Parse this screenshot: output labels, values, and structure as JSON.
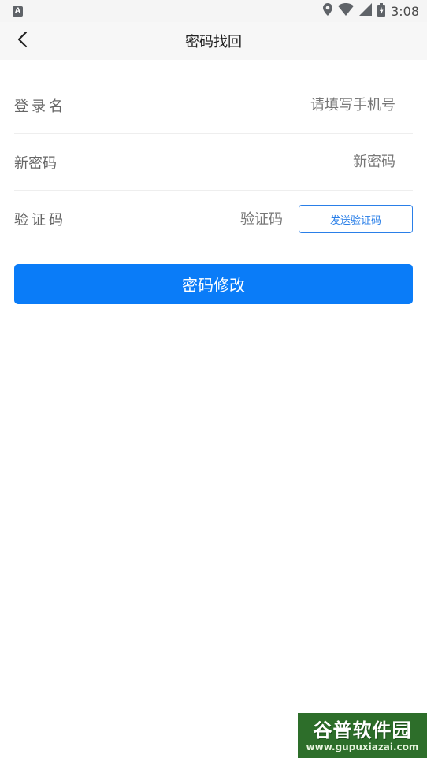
{
  "status_bar": {
    "app_icon_letter": "A",
    "time": "3:08"
  },
  "header": {
    "title": "密码找回"
  },
  "form": {
    "username": {
      "label": "登录名",
      "placeholder": "请填写手机号"
    },
    "new_password": {
      "label": "新密码",
      "placeholder": "新密码"
    },
    "code": {
      "label": "验证码",
      "placeholder": "验证码",
      "send_button": "发送验证码"
    }
  },
  "submit_label": "密码修改",
  "watermark": {
    "title": "谷普软件园",
    "url": "www.gupuxiazai.com"
  },
  "colors": {
    "primary": "#0a7cf8",
    "outline": "#2a7fe8",
    "header_bg": "#f7f7f7"
  }
}
